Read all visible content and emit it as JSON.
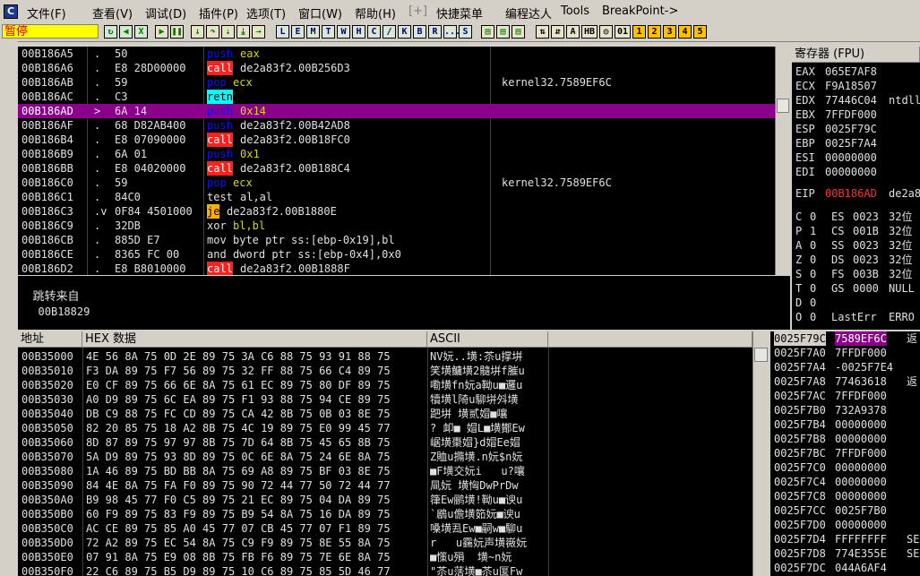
{
  "menu": {
    "app_icon": "C",
    "items": [
      "文件(F)",
      "查看(V)",
      "调试(D)",
      "插件(P)",
      "选项(T)",
      "窗口(W)",
      "帮助(H)",
      "[+]",
      "快捷菜单",
      "编程达人",
      "Tools",
      "BreakPoint->"
    ]
  },
  "toolbar": {
    "status": "暂停",
    "letter_buttons": [
      "L",
      "E",
      "M",
      "T",
      "W",
      "H",
      "C",
      "/",
      "K",
      "B",
      "R",
      "...",
      "S"
    ],
    "number_buttons": [
      "1",
      "2",
      "3",
      "4",
      "5"
    ]
  },
  "disasm": {
    "rows": [
      {
        "addr": "00B186A5",
        "mark": ".",
        "hex": "50",
        "mn": "push",
        "ops": "eax",
        "comment": ""
      },
      {
        "addr": "00B186A6",
        "mark": ".",
        "hex": "E8 28D00000",
        "mn": "call",
        "ops": "de2a83f2.00B256D3",
        "comment": ""
      },
      {
        "addr": "00B186AB",
        "mark": ".",
        "hex": "59",
        "mn": "pop",
        "ops": "ecx",
        "comment": "kernel32.7589EF6C"
      },
      {
        "addr": "00B186AC",
        "mark": ".",
        "hex": "C3",
        "mn": "retn",
        "ops": "",
        "comment": ""
      },
      {
        "addr": "00B186AD",
        "mark": ">",
        "hex": "6A 14",
        "mn": "push",
        "ops": "0x14",
        "comment": ""
      },
      {
        "addr": "00B186AF",
        "mark": ".",
        "hex": "68 D82AB400",
        "mn": "push",
        "ops": "de2a83f2.00B42AD8",
        "comment": ""
      },
      {
        "addr": "00B186B4",
        "mark": ".",
        "hex": "E8 07090000",
        "mn": "call",
        "ops": "de2a83f2.00B18FC0",
        "comment": ""
      },
      {
        "addr": "00B186B9",
        "mark": ".",
        "hex": "6A 01",
        "mn": "push",
        "ops": "0x1",
        "comment": ""
      },
      {
        "addr": "00B186BB",
        "mark": ".",
        "hex": "E8 04020000",
        "mn": "call",
        "ops": "de2a83f2.00B188C4",
        "comment": ""
      },
      {
        "addr": "00B186C0",
        "mark": ".",
        "hex": "59",
        "mn": "pop",
        "ops": "ecx",
        "comment": "kernel32.7589EF6C"
      },
      {
        "addr": "00B186C1",
        "mark": ".",
        "hex": "84C0",
        "mn": "test",
        "ops": "al,al",
        "comment": ""
      },
      {
        "addr": "00B186C3",
        "mark": ".v",
        "hex": "0F84 4501000",
        "mn": "je",
        "ops": "de2a83f2.00B1880E",
        "comment": ""
      },
      {
        "addr": "00B186C9",
        "mark": ".",
        "hex": "32DB",
        "mn": "xor",
        "ops": "bl,bl",
        "comment": ""
      },
      {
        "addr": "00B186CB",
        "mark": ".",
        "hex": "885D E7",
        "mn": "mov",
        "ops": "byte ptr ss:[ebp-0x19],bl",
        "comment": ""
      },
      {
        "addr": "00B186CE",
        "mark": ".",
        "hex": "8365 FC 00",
        "mn": "and",
        "ops": "dword ptr ss:[ebp-0x4],0x0",
        "comment": ""
      },
      {
        "addr": "00B186D2",
        "mark": ".",
        "hex": "E8 B8010000",
        "mn": "call",
        "ops": "de2a83f2.00B1888F",
        "comment": ""
      }
    ],
    "selected_index": 4
  },
  "info": {
    "label": "跳转来自",
    "value": "00B18829"
  },
  "registers": {
    "title": "寄存器 (FPU)",
    "gp": [
      {
        "name": "EAX",
        "val": "065E7AF8",
        "extra": ""
      },
      {
        "name": "ECX",
        "val": "F9A18507",
        "extra": ""
      },
      {
        "name": "EDX",
        "val": "77446C04",
        "extra": "ntdll"
      },
      {
        "name": "EBX",
        "val": "7FFDF000",
        "extra": ""
      },
      {
        "name": "ESP",
        "val": "0025F79C",
        "extra": ""
      },
      {
        "name": "EBP",
        "val": "0025F7A4",
        "extra": ""
      },
      {
        "name": "ESI",
        "val": "00000000",
        "extra": ""
      },
      {
        "name": "EDI",
        "val": "00000000",
        "extra": ""
      }
    ],
    "eip": {
      "name": "EIP",
      "val": "00B186AD",
      "extra": "de2a8"
    },
    "flags": [
      {
        "f": "C",
        "v": "0",
        "seg": "ES",
        "sv": "0023",
        "bits": "32位"
      },
      {
        "f": "P",
        "v": "1",
        "seg": "CS",
        "sv": "001B",
        "bits": "32位"
      },
      {
        "f": "A",
        "v": "0",
        "seg": "SS",
        "sv": "0023",
        "bits": "32位"
      },
      {
        "f": "Z",
        "v": "0",
        "seg": "DS",
        "sv": "0023",
        "bits": "32位"
      },
      {
        "f": "S",
        "v": "0",
        "seg": "FS",
        "sv": "003B",
        "bits": "32位"
      },
      {
        "f": "T",
        "v": "0",
        "seg": "GS",
        "sv": "0000",
        "bits": "NULL"
      },
      {
        "f": "D",
        "v": "0",
        "seg": "",
        "sv": "",
        "bits": ""
      },
      {
        "f": "O",
        "v": "0",
        "seg": "LastErr",
        "sv": "",
        "bits": "ERRO"
      }
    ]
  },
  "dump": {
    "headers": {
      "addr": "地址",
      "hex": "HEX 数据",
      "ascii": "ASCII"
    },
    "rows": [
      {
        "addr": "00B35000",
        "hex": "4E 56 8A 75 0D 2E 89 75 3A C6 88 75 93 91 88 75",
        "ascii": "NV妧..墴:苶u撑垪"
      },
      {
        "addr": "00B35010",
        "hex": "F3 DA 89 75 F7 56 89 75 32 FF 88 75 66 C4 89 75",
        "ascii": "笑墴鳙墴2髓垪f膗u"
      },
      {
        "addr": "00B35020",
        "hex": "E0 CF 89 75 66 6E 8A 75 61 EC 89 75 80 DF 89 75",
        "ascii": "嘞墴fn妧a靿u■邏u"
      },
      {
        "addr": "00B35030",
        "hex": "A0 D9 89 75 6C EA 89 75 F1 93 88 75 94 CE 89 75",
        "ascii": "犢墴l陭u駠垪斘墴"
      },
      {
        "addr": "00B35040",
        "hex": "DB C9 88 75 FC CD 89 75 CA 42 8B 75 0B 03 8E 75",
        "ascii": "跁垪 墴贰媢■嚷"
      },
      {
        "addr": "00B35050",
        "hex": "82 20 85 75 18 A2 8B 75 4C 19 89 75 E0 99 45 77",
        "ascii": "? 卹■ 媢L■墴鄼Ew"
      },
      {
        "addr": "00B35060",
        "hex": "8D 87 89 75 97 97 8B 75 7D 64 8B 75 45 65 8B 75",
        "ascii": "崌墴棗媢}d媢Ee媢"
      },
      {
        "addr": "00B35070",
        "hex": "5A D9 89 75 93 8D 89 75 0C 6E 8A 75 24 6E 8A 75",
        "ascii": "Z賉u撱墴.n妧$n妧"
      },
      {
        "addr": "00B35080",
        "hex": "1A 46 89 75 BD BB 8A 75 69 A8 89 75 BF 03 8E 75",
        "ascii": "■F墴交妧i   u?嚷"
      },
      {
        "addr": "00B35090",
        "hex": "84 4E 8A 75 FA F0 89 75 90 72 44 77 50 72 44 77",
        "ascii": "凬妧 墴恟DwPrDw"
      },
      {
        "addr": "00B350A0",
        "hex": "B9 98 45 77 F0 C5 89 75 21 EC 89 75 04 DA 89 75",
        "ascii": "箻Ew鹂墴!靿u■谀u"
      },
      {
        "addr": "00B350B0",
        "hex": "60 F9 89 75 83 F9 89 75 B9 54 8A 75 16 DA 89 75",
        "ascii": "`鶋u儋墴筎妧■谀u"
      },
      {
        "addr": "00B350C0",
        "hex": "AC CE 89 75 85 A0 45 77 07 CB 45 77 07 F1 89 75",
        "ascii": "嗓墴厾Ew■嗣w■駠u"
      },
      {
        "addr": "00B350D0",
        "hex": "72 A2 89 75 EC 54 8A 75 C9 F9 89 75 8E 55 8A 75",
        "ascii": "r   u靎妧声墴嶶妧"
      },
      {
        "addr": "00B350E0",
        "hex": "07 91 8A 75 E9 08 8B 75 FB F6 89 75 7E 6E 8A 75",
        "ascii": "■憡u殞  墴~n妧"
      },
      {
        "addr": "00B350F0",
        "hex": "22 C6 89 75 B5 D9 89 75 10 C6 89 75 85 5D 46 77",
        "ascii": "\"苶u萿墴■苶u匽Fw"
      }
    ]
  },
  "stack": {
    "rows": [
      {
        "addr": "0025F79C",
        "val": "7589EF6C",
        "note": "返"
      },
      {
        "addr": "0025F7A0",
        "val": "7FFDF000",
        "note": ""
      },
      {
        "addr": "0025F7A4",
        "val": "-0025F7E4",
        "note": ""
      },
      {
        "addr": "0025F7A8",
        "val": "77463618",
        "note": "返"
      },
      {
        "addr": "0025F7AC",
        "val": "7FFDF000",
        "note": ""
      },
      {
        "addr": "0025F7B0",
        "val": "732A9378",
        "note": ""
      },
      {
        "addr": "0025F7B4",
        "val": "00000000",
        "note": ""
      },
      {
        "addr": "0025F7B8",
        "val": "00000000",
        "note": ""
      },
      {
        "addr": "0025F7BC",
        "val": "7FFDF000",
        "note": ""
      },
      {
        "addr": "0025F7C0",
        "val": "00000000",
        "note": ""
      },
      {
        "addr": "0025F7C4",
        "val": "00000000",
        "note": ""
      },
      {
        "addr": "0025F7C8",
        "val": "00000000",
        "note": ""
      },
      {
        "addr": "0025F7CC",
        "val": "0025F7B0",
        "note": ""
      },
      {
        "addr": "0025F7D0",
        "val": "00000000",
        "note": ""
      },
      {
        "addr": "0025F7D4",
        "val": "FFFFFFFF",
        "note": "SE"
      },
      {
        "addr": "0025F7D8",
        "val": "774E355E",
        "note": "SE"
      },
      {
        "addr": "0025F7DC",
        "val": "044A6AF4",
        "note": ""
      }
    ]
  },
  "colors": {
    "selected_row": "#8b008b",
    "call": "#ff2020",
    "push": "#1010ff",
    "retn": "#00ffff",
    "je": "#ffb000",
    "status_bg": "#ffff00"
  }
}
